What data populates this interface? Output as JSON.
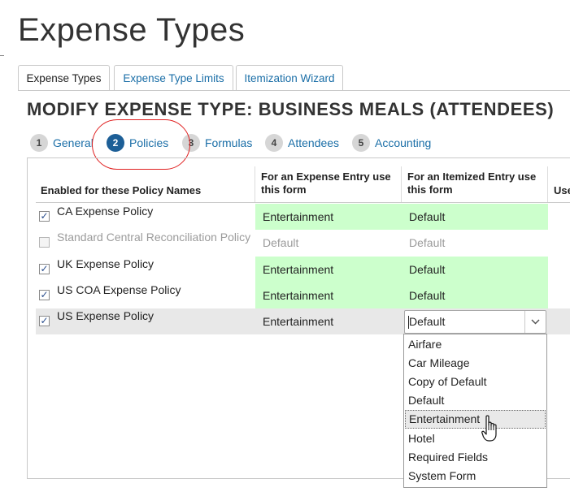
{
  "page": {
    "title": "Expense Types"
  },
  "tabs": [
    "Expense Types",
    "Expense Type Limits",
    "Itemization Wizard"
  ],
  "modify_title": "MODIFY EXPENSE TYPE: BUSINESS MEALS (ATTENDEES)",
  "steps": [
    {
      "num": "1",
      "label": "General"
    },
    {
      "num": "2",
      "label": "Policies"
    },
    {
      "num": "3",
      "label": "Formulas"
    },
    {
      "num": "4",
      "label": "Attendees"
    },
    {
      "num": "5",
      "label": "Accounting"
    }
  ],
  "table": {
    "headers": [
      "Enabled for these Policy Names",
      "For an Expense Entry use this form",
      "For an Itemized Entry use this form",
      "Use"
    ],
    "rows": [
      {
        "name": "CA Expense Policy",
        "checked": true,
        "entry_form": "Entertainment",
        "itemized_form": "Default"
      },
      {
        "name": "Standard Central Reconciliation Policy",
        "checked": false,
        "entry_form": "Default",
        "itemized_form": "Default"
      },
      {
        "name": "UK Expense Policy",
        "checked": true,
        "entry_form": "Entertainment",
        "itemized_form": "Default"
      },
      {
        "name": "US COA Expense Policy",
        "checked": true,
        "entry_form": "Entertainment",
        "itemized_form": "Default"
      },
      {
        "name": "US Expense Policy",
        "checked": true,
        "entry_form": "Entertainment",
        "itemized_form": "Default"
      }
    ]
  },
  "dropdown": {
    "selected": "Default",
    "hovered": "Entertainment",
    "options": [
      "Airfare",
      "Car Mileage",
      "Copy of Default",
      "Default",
      "Entertainment",
      "Hotel",
      "Required Fields",
      "System Form"
    ]
  },
  "colors": {
    "enabled_cell": "#ccffcc",
    "link": "#1a6ea7",
    "active_step": "#1d5f97",
    "annotation": "#e02020"
  }
}
